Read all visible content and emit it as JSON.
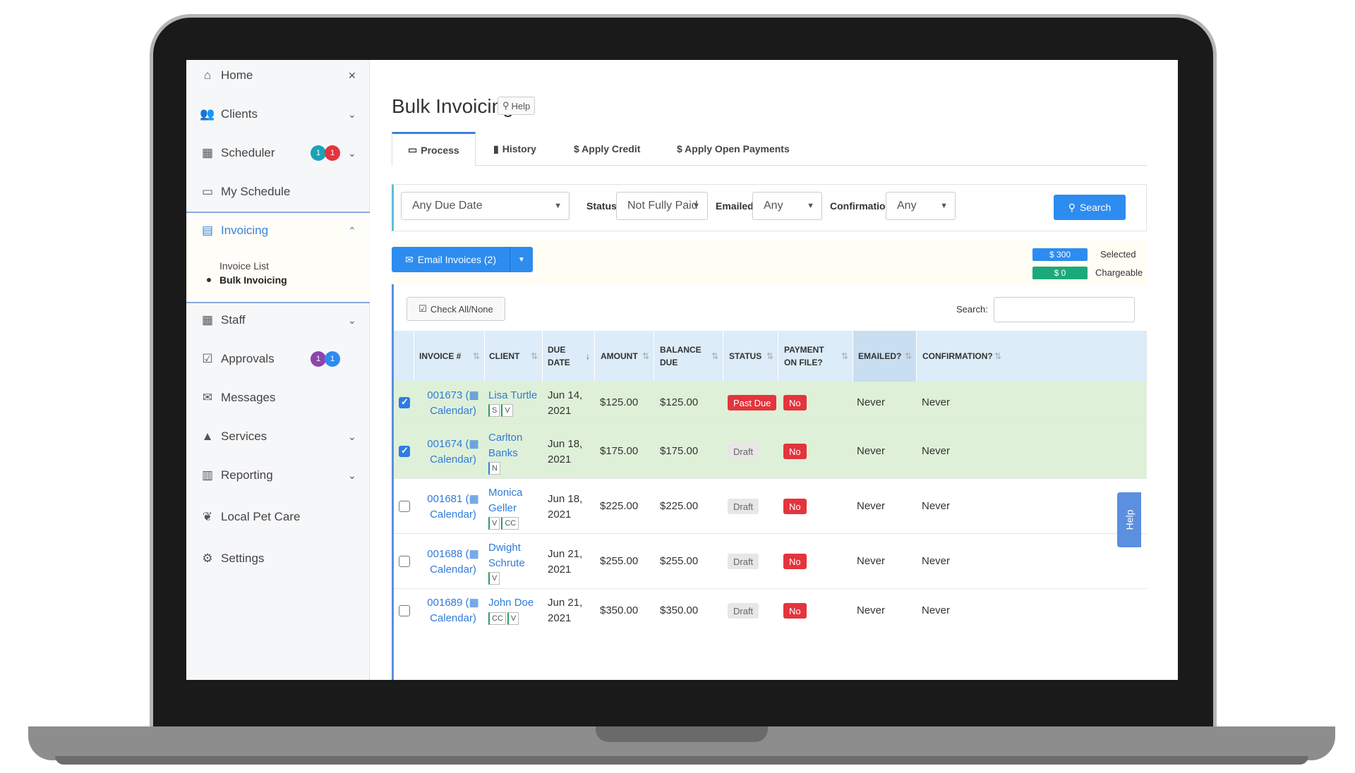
{
  "sidebar": {
    "items": [
      {
        "label": "Home",
        "icon": "home-icon"
      },
      {
        "label": "Clients",
        "icon": "users-icon"
      },
      {
        "label": "Scheduler",
        "icon": "calendar-icon",
        "badges": [
          "1",
          "1"
        ]
      },
      {
        "label": "My Schedule",
        "icon": "calendar-blank-icon"
      },
      {
        "label": "Invoicing",
        "icon": "credit-card-icon"
      },
      {
        "label": "Staff",
        "icon": "grid-icon"
      },
      {
        "label": "Approvals",
        "icon": "checkbox-icon",
        "badges": [
          "1",
          "1"
        ]
      },
      {
        "label": "Messages",
        "icon": "envelope-icon"
      },
      {
        "label": "Services",
        "icon": "road-icon"
      },
      {
        "label": "Reporting",
        "icon": "bar-chart-icon"
      },
      {
        "label": "Local Pet Care",
        "icon": "paw-icon"
      },
      {
        "label": "Settings",
        "icon": "gears-icon"
      }
    ],
    "invoicing_sub": [
      "Invoice List",
      "Bulk Invoicing"
    ],
    "badge_colors": {
      "purple": "#8e44ad",
      "teal": "#1aa3b8",
      "red": "#e4343d",
      "blue": "#2d8cf0"
    }
  },
  "page": {
    "title": "Bulk Invoicing",
    "help_label": "Help"
  },
  "tabs": [
    "Process",
    "History",
    "$ Apply Credit",
    "$ Apply Open Payments"
  ],
  "filters": {
    "due_date": "Any Due Date",
    "status_label": "Status:",
    "status": "Not Fully Paid",
    "emailed_label": "Emailed:",
    "emailed": "Any",
    "confirmation_label": "Confirmation:",
    "confirmation": "Any",
    "search_button": "Search"
  },
  "actions": {
    "email_button": "Email Invoices (2)",
    "selected_amount": "$ 300",
    "selected_label": "Selected",
    "chargeable_amount": "$ 0",
    "chargeable_label": "Chargeable"
  },
  "table": {
    "check_all": "Check All/None",
    "search_label": "Search:",
    "columns": [
      "INVOICE #",
      "CLIENT",
      "DUE DATE",
      "AMOUNT",
      "BALANCE DUE",
      "STATUS",
      "PAYMENT ON FILE?",
      "EMAILED?",
      "CONFIRMATION?"
    ],
    "rows": [
      {
        "checked": true,
        "invoice": "001673",
        "calendar": "Calendar)",
        "client": [
          "Lisa Turtle"
        ],
        "tags": [
          "S",
          "V"
        ],
        "due": [
          "Jun 14,",
          "2021"
        ],
        "amount": "$125.00",
        "balance": "$125.00",
        "status": "Past Due",
        "payment": "No",
        "emailed": "Never",
        "confirmation": "Never"
      },
      {
        "checked": true,
        "invoice": "001674",
        "calendar": "Calendar)",
        "client": [
          "Carlton",
          "Banks"
        ],
        "tags": [
          "N"
        ],
        "due": [
          "Jun 18,",
          "2021"
        ],
        "amount": "$175.00",
        "balance": "$175.00",
        "status": "Draft",
        "payment": "No",
        "emailed": "Never",
        "confirmation": "Never"
      },
      {
        "checked": false,
        "invoice": "001681",
        "calendar": "Calendar)",
        "client": [
          "Monica",
          "Geller"
        ],
        "tags": [
          "V",
          "CC"
        ],
        "due": [
          "Jun 18,",
          "2021"
        ],
        "amount": "$225.00",
        "balance": "$225.00",
        "status": "Draft",
        "payment": "No",
        "emailed": "Never",
        "confirmation": "Never"
      },
      {
        "checked": false,
        "invoice": "001688",
        "calendar": "Calendar)",
        "client": [
          "Dwight",
          "Schrute"
        ],
        "tags": [
          "V"
        ],
        "due": [
          "Jun 21,",
          "2021"
        ],
        "amount": "$255.00",
        "balance": "$255.00",
        "status": "Draft",
        "payment": "No",
        "emailed": "Never",
        "confirmation": "Never"
      },
      {
        "checked": false,
        "invoice": "001689",
        "calendar": "Calendar)",
        "client": [
          "John Doe"
        ],
        "tags": [
          "CC",
          "V"
        ],
        "due": [
          "Jun 21,",
          "2021"
        ],
        "amount": "$350.00",
        "balance": "$350.00",
        "status": "Draft",
        "payment": "No",
        "emailed": "Never",
        "confirmation": "Never"
      }
    ]
  },
  "help_tab": "Help"
}
